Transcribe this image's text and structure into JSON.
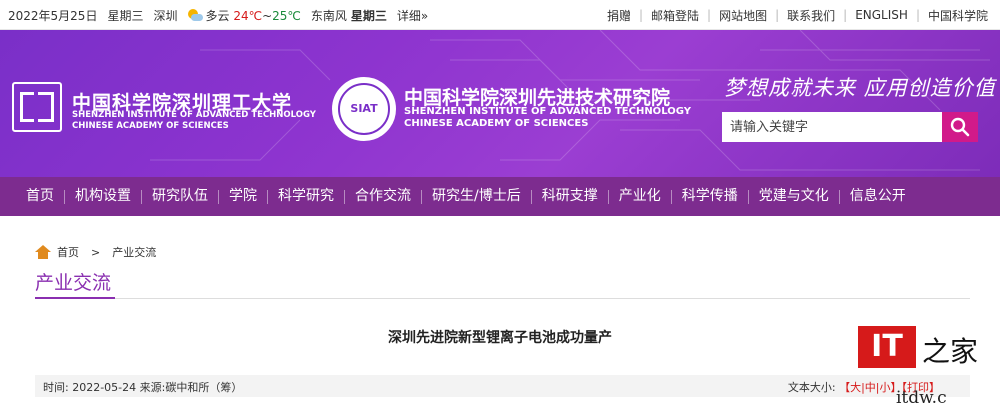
{
  "topbar": {
    "date": "2022年5月25日",
    "weekday": "星期三",
    "city": "深圳",
    "weather": "多云",
    "temp_high": "24℃",
    "temp_sep": "~",
    "temp_low": "25℃",
    "wind": "东南风",
    "wind_day": "星期三",
    "detail": "详细»",
    "links": [
      "捐赠",
      "邮箱登陆",
      "网站地图",
      "联系我们",
      "ENGLISH",
      "中国科学院"
    ],
    "separator": "|"
  },
  "banner": {
    "org1_cn": "中国科学院深圳理工大学",
    "org1_en": [
      "SHENZHEN INSTITUTE OF ADVANCED TECHNOLOGY",
      "CHINESE ACADEMY OF SCIENCES"
    ],
    "seal_text": "SIAT",
    "org2_cn": "中国科学院深圳先进技术研究院",
    "org2_en": [
      "SHENZHEN INSTITUTE OF ADVANCED TECHNOLOGY",
      "CHINESE ACADEMY OF SCIENCES"
    ],
    "slogan": "梦想成就未来  应用创造价值",
    "search_placeholder": "请输入关键字",
    "colors": {
      "primary": "#7a2fc8",
      "search_button": "#d11a8a"
    }
  },
  "nav": {
    "items": [
      "首页",
      "机构设置",
      "研究队伍",
      "学院",
      "科学研究",
      "合作交流",
      "研究生/博士后",
      "科研支撑",
      "产业化",
      "科学传播",
      "党建与文化",
      "信息公开"
    ],
    "color": "#7d2c8f"
  },
  "breadcrumb": {
    "home": "首页",
    "sep": ">",
    "current": "产业交流"
  },
  "section": {
    "title": "产业交流"
  },
  "article": {
    "title": "深圳先进院新型锂离子电池成功量产",
    "time_label": "时间:",
    "time": "2022-05-24",
    "source_label": "来源:",
    "source": "碳中和所（筹）",
    "text_size_label": "文本大小:",
    "text_size_options": [
      "大",
      "中",
      "小"
    ],
    "print": "打印"
  },
  "watermark": {
    "it": "IT",
    "cn": "之家",
    "url": "itdw.c"
  }
}
